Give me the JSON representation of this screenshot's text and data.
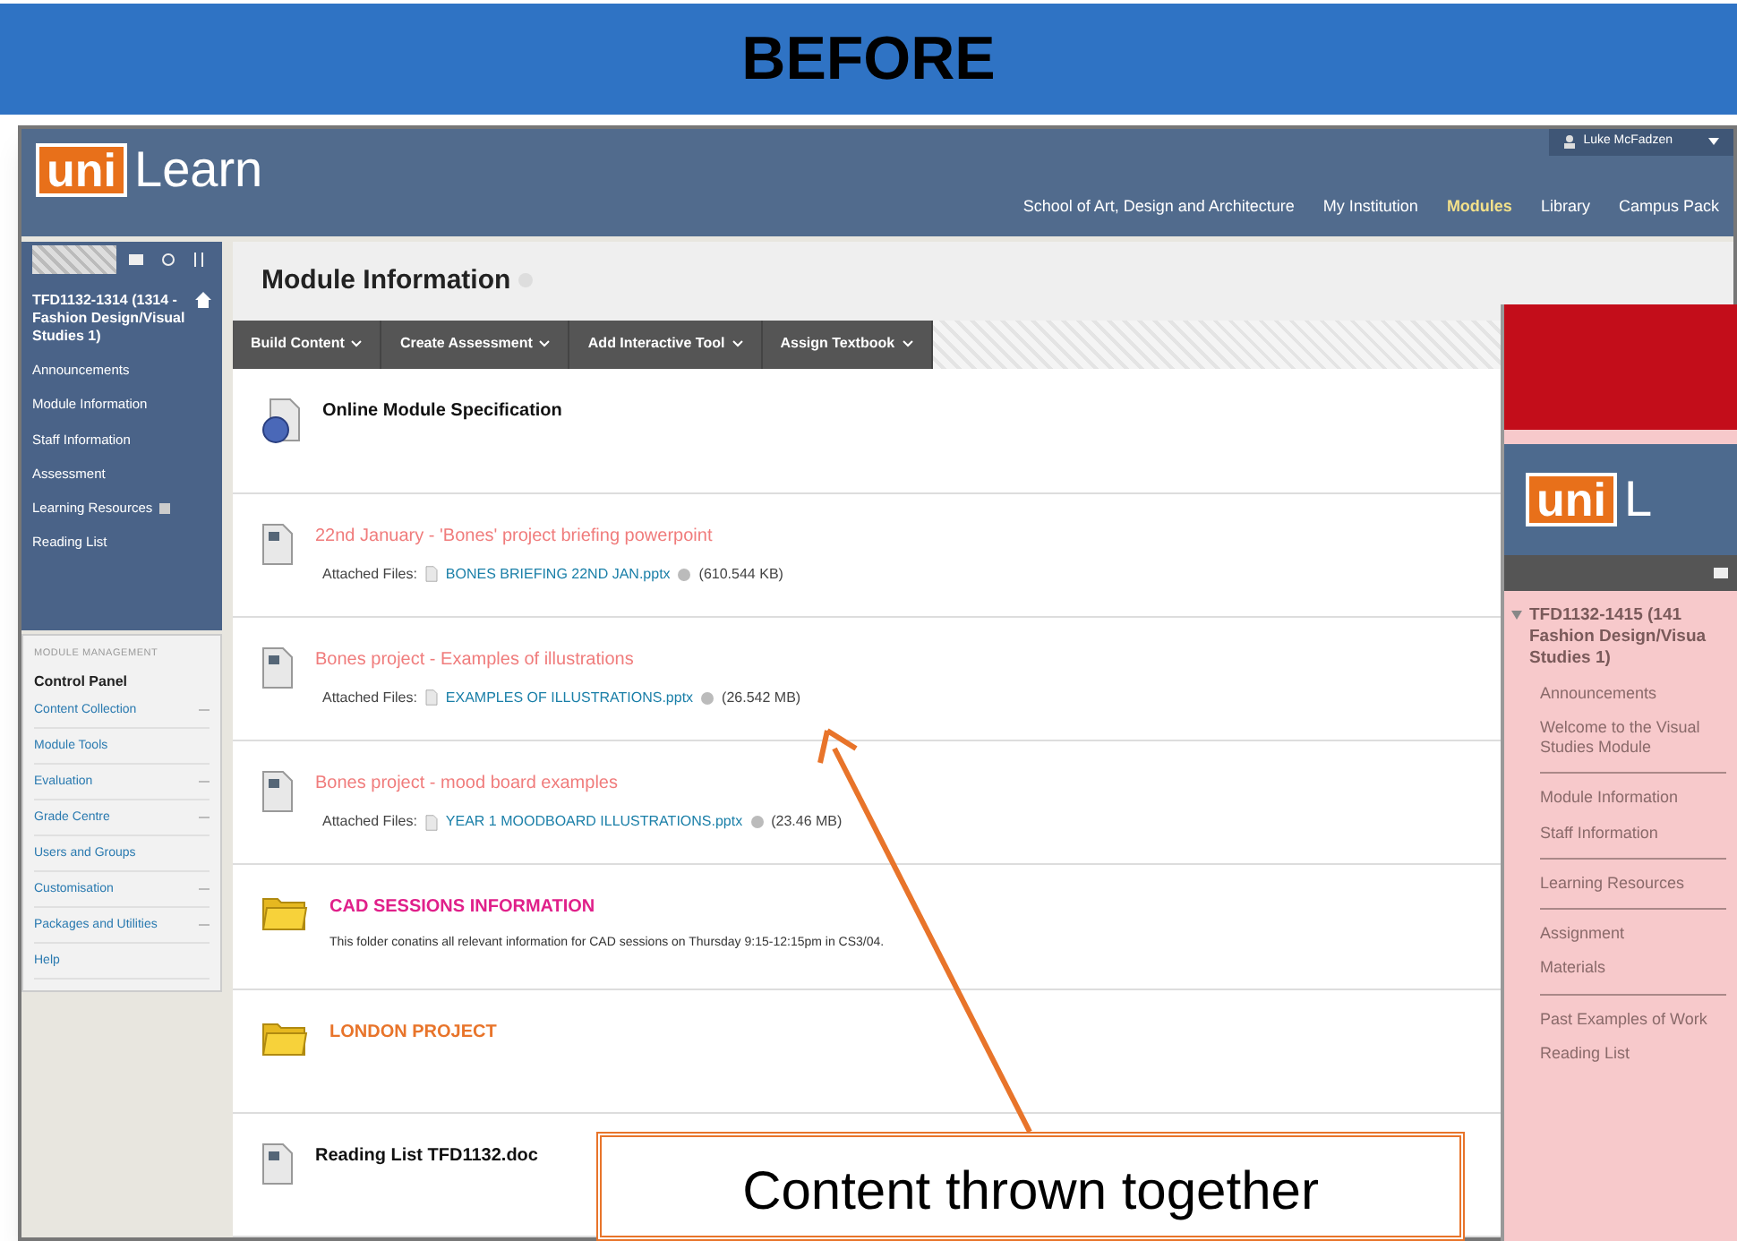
{
  "banner": {
    "title": "BEFORE"
  },
  "main_screenshot": {
    "logo": {
      "part_1": "uni",
      "part_2": "Learn"
    },
    "user": "Luke McFadzen",
    "nav": [
      {
        "label": "School of Art, Design and Architecture",
        "selected": false
      },
      {
        "label": "My Institution",
        "selected": false
      },
      {
        "label": "Modules",
        "selected": true
      },
      {
        "label": "Library",
        "selected": false
      },
      {
        "label": "Campus Pack",
        "selected": false
      }
    ],
    "sidebar": {
      "course": "TFD1132-1314 (1314 - Fashion Design/Visual Studies 1)",
      "items": [
        {
          "label": "Announcements",
          "kind": "plain"
        },
        {
          "label": "Module Information",
          "kind": "plain"
        },
        {
          "label": "Staff Information",
          "kind": "plain"
        },
        {
          "label": "Assessment",
          "kind": "plain"
        },
        {
          "label": "Learning Resources",
          "kind": "flagged"
        },
        {
          "label": "Reading List",
          "kind": "plain"
        }
      ],
      "management": {
        "heading": "MODULE MANAGEMENT",
        "title": "Control Panel",
        "items": [
          {
            "label": "Content Collection",
            "expandable": true
          },
          {
            "label": "Module Tools",
            "expandable": false
          },
          {
            "label": "Evaluation",
            "expandable": true
          },
          {
            "label": "Grade Centre",
            "expandable": true
          },
          {
            "label": "Users and Groups",
            "expandable": false
          },
          {
            "label": "Customisation",
            "expandable": true
          },
          {
            "label": "Packages and Utilities",
            "expandable": true
          },
          {
            "label": "Help",
            "expandable": false
          }
        ]
      }
    },
    "content": {
      "title": "Module Information",
      "toolbar": [
        "Build Content",
        "Create Assessment",
        "Add Interactive Tool",
        "Assign Textbook"
      ],
      "items": [
        {
          "kind": "link",
          "title": "Online Module Specification",
          "color": "#111111"
        },
        {
          "kind": "file",
          "title": "22nd January - 'Bones' project briefing powerpoint",
          "color": "#f07c7c",
          "attached_label": "Attached Files:",
          "file": "BONES BRIEFING 22ND JAN.pptx",
          "size": "(610.544 KB)"
        },
        {
          "kind": "file",
          "title": "Bones project - Examples of illustrations",
          "color": "#f07c7c",
          "attached_label": "Attached Files:",
          "file": "EXAMPLES OF ILLUSTRATIONS.pptx",
          "size": "(26.542 MB)"
        },
        {
          "kind": "file",
          "title": "Bones project - mood board examples",
          "color": "#f07c7c",
          "attached_label": "Attached Files:",
          "file": "YEAR 1 MOODBOARD ILLUSTRATIONS.pptx",
          "size": "(23.46 MB)"
        },
        {
          "kind": "folder",
          "title": "CAD SESSIONS INFORMATION",
          "color": "#e0208a",
          "description": "This folder conatins all relevant information for CAD sessions on Thursday 9:15-12:15pm in CS3/04."
        },
        {
          "kind": "folder",
          "title": "LONDON PROJECT",
          "color": "#e8742a"
        },
        {
          "kind": "document",
          "title": "Reading List TFD1132.doc",
          "color": "#111111"
        }
      ]
    }
  },
  "after_screenshot": {
    "logo": {
      "part_1": "uni",
      "part_2": "L"
    },
    "course_lines": [
      "TFD1132-1415 (141",
      "Fashion Design/Visua",
      "Studies 1)"
    ],
    "groups": [
      [
        "Announcements",
        "Welcome to the Visual Studies Module"
      ],
      [
        "Module Information",
        "Staff Information"
      ],
      [
        "Learning Resources"
      ],
      [
        "Assignment",
        "Materials"
      ],
      [
        "Past Examples of Work",
        "Reading List"
      ]
    ]
  },
  "callout": {
    "text": "Content thrown together"
  }
}
